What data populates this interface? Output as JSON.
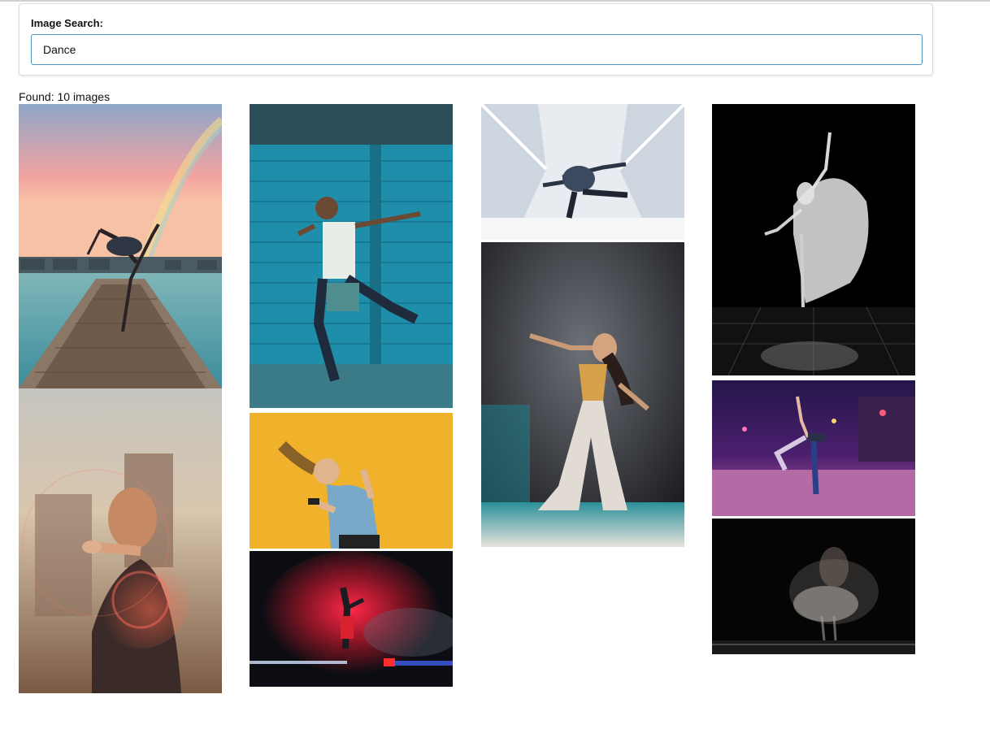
{
  "search": {
    "label": "Image Search:",
    "value": "Dance"
  },
  "results": {
    "found_text": "Found: 10 images"
  }
}
